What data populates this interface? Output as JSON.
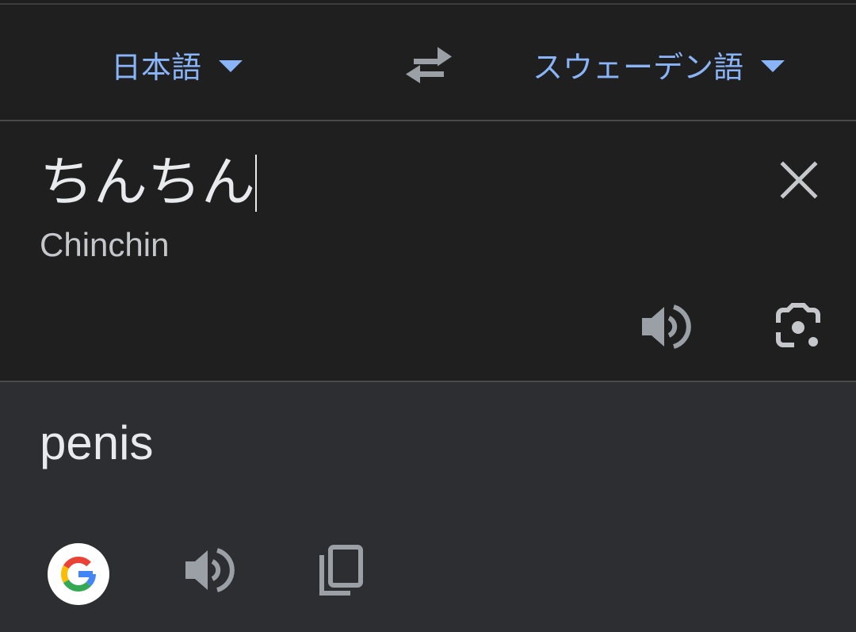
{
  "language_bar": {
    "source_language": "日本語",
    "target_language": "スウェーデン語"
  },
  "input": {
    "text": "ちんちん",
    "romanization": "Chinchin"
  },
  "output": {
    "text": "penis"
  },
  "icons": {
    "swap": "swap-arrows-icon",
    "clear": "close-icon",
    "listen_source": "speaker-icon",
    "camera": "camera-lens-icon",
    "google": "google-logo-icon",
    "listen_target": "speaker-icon",
    "copy": "copy-icon"
  },
  "colors": {
    "accent": "#8ab4f8",
    "background": "#1f1f1f",
    "output_background": "#2d2e31",
    "icon_gray": "#9aa0a6",
    "text": "#e8eaed"
  }
}
